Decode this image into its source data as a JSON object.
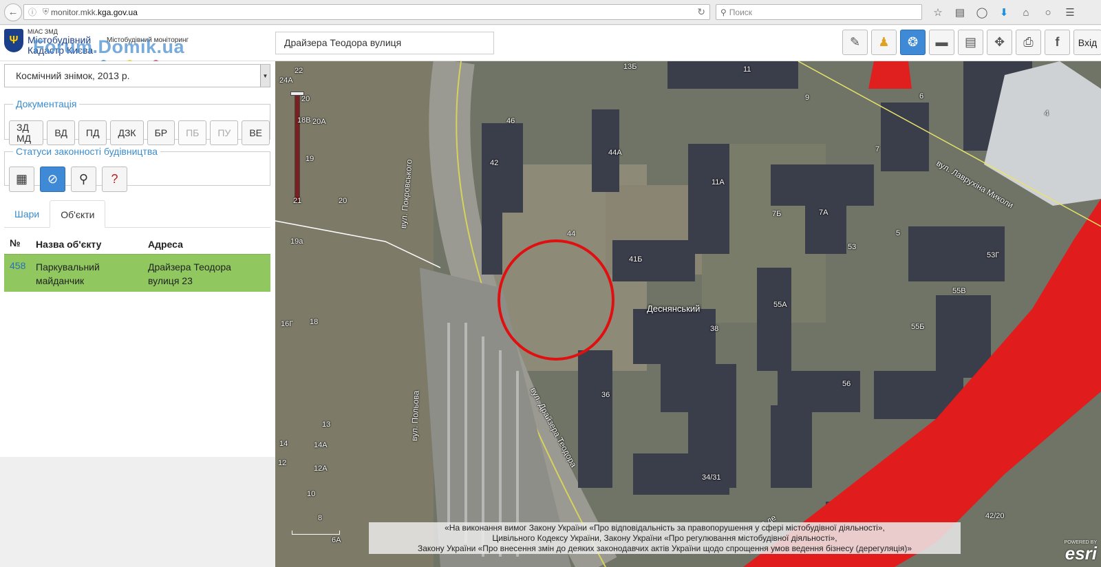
{
  "browser": {
    "url_prefix": "monitor.mkk.",
    "url_domain": "kga.gov.ua",
    "search_placeholder": "Поиск"
  },
  "header": {
    "logo_small": "МІАС ЗМД",
    "logo_title_line1": "Містобудівний",
    "logo_title_line2": "Кадастр Києва",
    "logo_subtitle": "Містобудівний моніторинг",
    "watermark": "Forum.Domik.ua",
    "address_value": "Драйзера Теодора вулиця",
    "exit_label": "Вхід",
    "dot_colors": [
      "#5aa0d8",
      "#d8d84a",
      "#d8608a"
    ]
  },
  "left_panel": {
    "basemap_selected": "Космічний знімок, 2013 р.",
    "documentation_legend": "Документація",
    "doc_buttons": [
      "ЗД МД",
      "ВД",
      "ПД",
      "ДЗК",
      "БР",
      "ПБ",
      "ПУ",
      "ВЕ"
    ],
    "status_legend": "Статуси законності будівництва",
    "tabs": [
      "Шари",
      "Об'єкти"
    ],
    "table_headers": [
      "№",
      "Назва об'єкту",
      "Адреса"
    ],
    "rows": [
      {
        "num": "458",
        "name_line1": "Паркувальний",
        "name_line2": "майданчик",
        "addr_line1": "Драйзера Теодора",
        "addr_line2": "вулиця 23"
      }
    ]
  },
  "map": {
    "district": "Деснянський",
    "streets": {
      "pokrovskoho": "вул. Покровського",
      "polska": "вул. Польова",
      "draizera": "вул. Драйзера Теодора",
      "lavrukhina": "вул. Лаврухіна Миколи",
      "honore": "Оноре де"
    },
    "labels": [
      "22",
      "24А",
      "20",
      "20А",
      "18В",
      "19",
      "20",
      "21",
      "19а",
      "16Г",
      "18",
      "13",
      "14",
      "14А",
      "12",
      "12А",
      "10",
      "8",
      "6А",
      "46",
      "42",
      "44",
      "13Б",
      "11",
      "9",
      "6",
      "4",
      "44А",
      "11А",
      "7",
      "7Б",
      "7А",
      "41Б",
      "53",
      "5",
      "53Г",
      "55А",
      "55Б",
      "55В",
      "38",
      "56",
      "36",
      "34/31",
      "42/20"
    ],
    "notice_line1": "«На виконання вимог Закону України «Про відповідальність за правопорушення у сфері містобудівної діяльності»,",
    "notice_line2": "Цивільного Кодексу України, Закону України «Про регулювання містобудівної діяльності»,",
    "notice_line3": "Закону України «Про внесення змін до деяких законодавчих актів України щодо спрощення умов ведення бізнесу (дерегуляція)»",
    "powered_by": "POWERED BY",
    "esri": "esri"
  }
}
